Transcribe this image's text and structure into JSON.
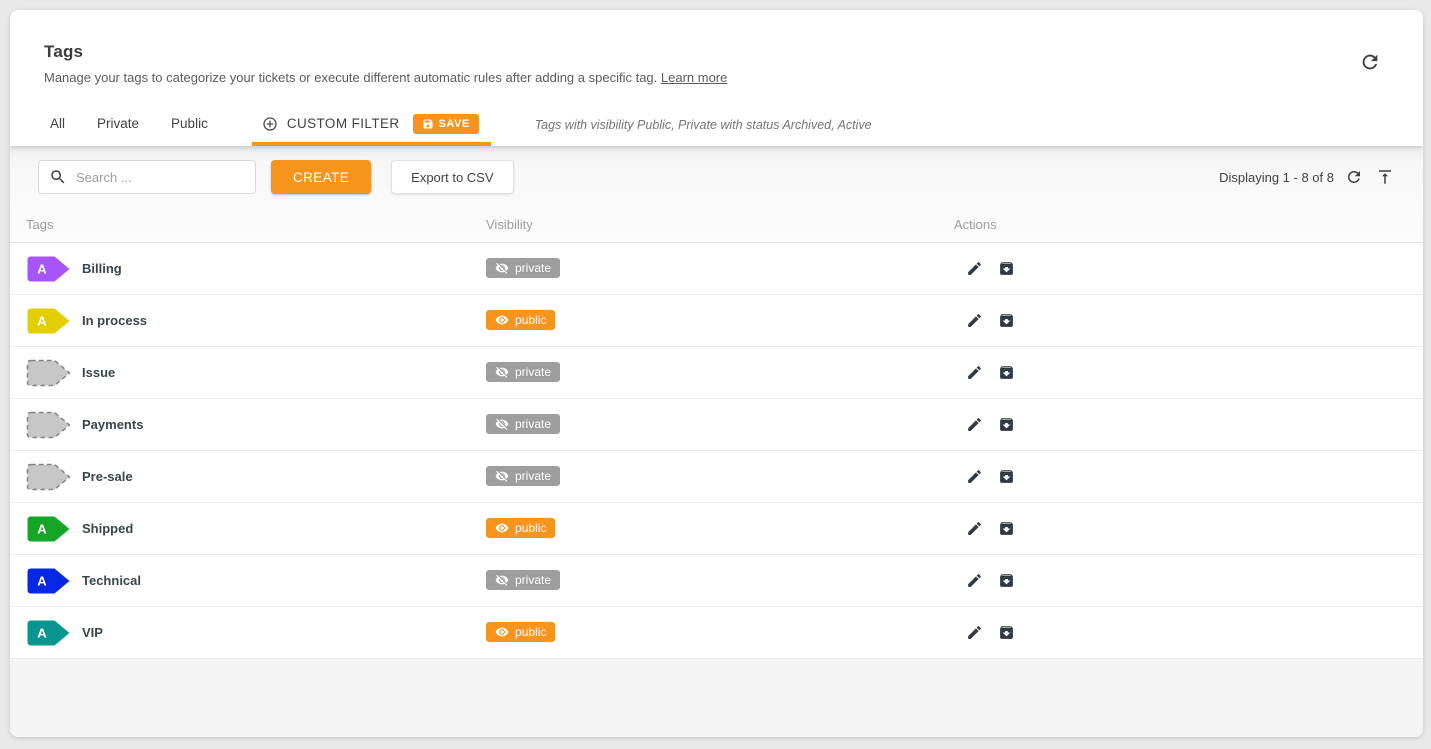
{
  "header": {
    "title": "Tags",
    "description": "Manage your tags to categorize your tickets or execute different automatic rules after adding a specific tag.",
    "learn_more_label": "Learn more"
  },
  "tabs": {
    "items": [
      {
        "label": "All",
        "active": false
      },
      {
        "label": "Private",
        "active": false
      },
      {
        "label": "Public",
        "active": false
      },
      {
        "label": "CUSTOM FILTER",
        "active": true
      }
    ],
    "save_label": "SAVE",
    "filter_description": "Tags with visibility Public, Private with status Archived, Active"
  },
  "toolbar": {
    "search_placeholder": "Search ...",
    "create_label": "CREATE",
    "export_label": "Export to CSV",
    "displaying_text": "Displaying 1 - 8 of 8"
  },
  "table": {
    "columns": [
      "Tags",
      "Visibility",
      "Actions"
    ],
    "rows": [
      {
        "name": "Billing",
        "letter": "A",
        "tag_color": "#a855f7",
        "archived": false,
        "visibility": "private"
      },
      {
        "name": "In process",
        "letter": "A",
        "tag_color": "#e3ce01",
        "archived": false,
        "visibility": "public"
      },
      {
        "name": "Issue",
        "letter": "",
        "tag_color": "#c7c7c7",
        "archived": true,
        "visibility": "private"
      },
      {
        "name": "Payments",
        "letter": "",
        "tag_color": "#c7c7c7",
        "archived": true,
        "visibility": "private"
      },
      {
        "name": "Pre-sale",
        "letter": "",
        "tag_color": "#c7c7c7",
        "archived": true,
        "visibility": "private"
      },
      {
        "name": "Shipped",
        "letter": "A",
        "tag_color": "#16a527",
        "archived": false,
        "visibility": "public"
      },
      {
        "name": "Technical",
        "letter": "A",
        "tag_color": "#0627e3",
        "archived": false,
        "visibility": "private"
      },
      {
        "name": "VIP",
        "letter": "A",
        "tag_color": "#0a968f",
        "archived": false,
        "visibility": "public"
      }
    ]
  },
  "badges": {
    "private": {
      "label": "private",
      "color": "#9e9e9e",
      "icon": "eye-off-icon"
    },
    "public": {
      "label": "public",
      "color": "#f6941d",
      "icon": "eye-icon"
    }
  },
  "colors": {
    "accent_orange": "#f6941d",
    "archived_fill": "#c7c7c7",
    "archived_stroke": "#858585",
    "private_gray": "#9e9e9e"
  }
}
